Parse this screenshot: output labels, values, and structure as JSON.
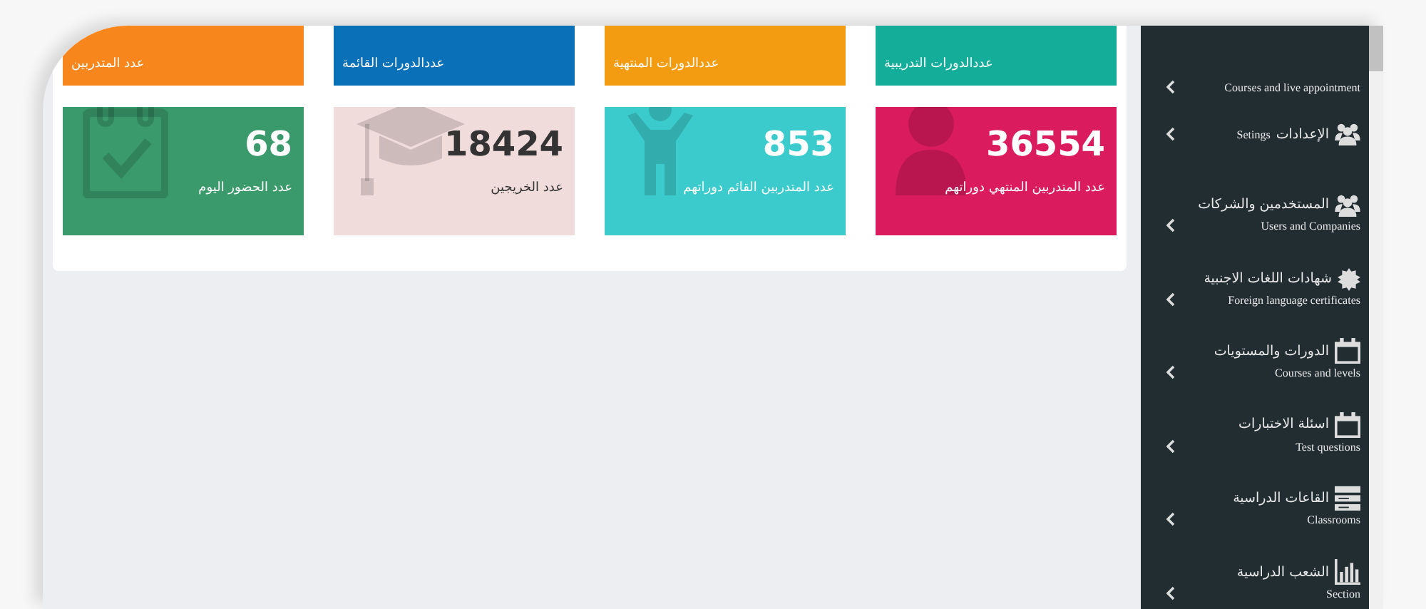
{
  "stat_cards_top": [
    {
      "label": "عددالدورات التدريبية",
      "color": "#14ad9a"
    },
    {
      "label": "عددالدورات المنتهية",
      "color": "#f39c12"
    },
    {
      "label": "عددالدورات القائمة",
      "color": "#0a70b8"
    },
    {
      "label": "عدد المتدربين",
      "color": "#f7861c"
    }
  ],
  "stat_cards": [
    {
      "value": "36554",
      "label": "عدد المتدربين المنتهي دوراتهم",
      "color": "#da1b5e"
    },
    {
      "value": "853",
      "label": "عدد المتدربين القائم دوراتهم",
      "color": "#3ccbcc"
    },
    {
      "value": "18424",
      "label": "عدد الخريجين",
      "color": "#f1dcdc"
    },
    {
      "value": "68",
      "label": "عدد الحضور اليوم",
      "color": "#3a9a6b"
    }
  ],
  "sidebar": {
    "items": [
      {
        "kind": "stacked",
        "english": "Courses and live appointment"
      },
      {
        "kind": "inline",
        "arabic": "الإعدادات",
        "english": "Setings"
      },
      {
        "kind": "stacked",
        "arabic": "المستخدمين والشركات",
        "english": "Users and Companies"
      },
      {
        "kind": "stacked",
        "arabic": "شهادات اللغات الاجنبية",
        "english": "Foreign language certificates"
      },
      {
        "kind": "stacked",
        "arabic": "الدورات والمستويات",
        "english": "Courses and levels"
      },
      {
        "kind": "stacked",
        "arabic": "اسئلة الاختبارات",
        "english": "Test questions"
      },
      {
        "kind": "stacked",
        "arabic": "القاعات الدراسية",
        "english": "Classrooms"
      },
      {
        "kind": "stacked",
        "arabic": "الشعب الدراسية",
        "english": "Section"
      }
    ]
  }
}
